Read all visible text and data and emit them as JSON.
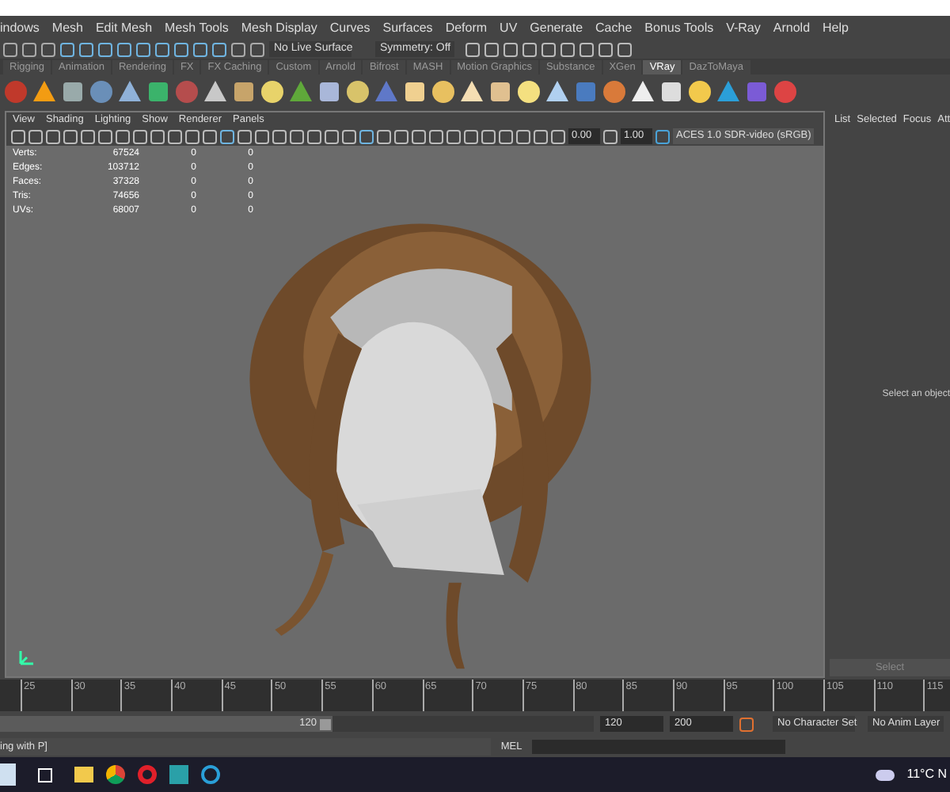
{
  "menu_bar": [
    "indows",
    "Mesh",
    "Edit Mesh",
    "Mesh Tools",
    "Mesh Display",
    "Curves",
    "Surfaces",
    "Deform",
    "UV",
    "Generate",
    "Cache",
    "Bonus Tools",
    "V-Ray",
    "Arnold",
    "Help"
  ],
  "status_line": {
    "live_surface": "No Live Surface",
    "symmetry": "Symmetry: Off"
  },
  "shelf_tabs": [
    {
      "label": "Rigging",
      "selected": false
    },
    {
      "label": "Animation",
      "selected": false
    },
    {
      "label": "Rendering",
      "selected": false
    },
    {
      "label": "FX",
      "selected": false
    },
    {
      "label": "FX Caching",
      "selected": false
    },
    {
      "label": "Custom",
      "selected": false
    },
    {
      "label": "Arnold",
      "selected": false
    },
    {
      "label": "Bifrost",
      "selected": false
    },
    {
      "label": "MASH",
      "selected": false
    },
    {
      "label": "Motion Graphics",
      "selected": false
    },
    {
      "label": "Substance",
      "selected": false
    },
    {
      "label": "XGen",
      "selected": false
    },
    {
      "label": "VRay",
      "selected": true
    },
    {
      "label": "DazToMaya",
      "selected": false
    }
  ],
  "viewport": {
    "menu": [
      "View",
      "Shading",
      "Lighting",
      "Show",
      "Renderer",
      "Panels"
    ],
    "exposure": "0.00",
    "gamma": "1.00",
    "color_space": "ACES 1.0 SDR-video (sRGB)",
    "stats": [
      [
        "Verts:",
        "67524",
        "0",
        "0"
      ],
      [
        "Edges:",
        "103712",
        "0",
        "0"
      ],
      [
        "Faces:",
        "37328",
        "0",
        "0"
      ],
      [
        "Tris:",
        "74656",
        "0",
        "0"
      ],
      [
        "UVs:",
        "68007",
        "0",
        "0"
      ]
    ]
  },
  "side_panel": {
    "tabs": [
      "List",
      "Selected",
      "Focus",
      "Att"
    ],
    "message": "Select an object",
    "button": "Select"
  },
  "timeline": {
    "ticks": [
      "25",
      "30",
      "35",
      "40",
      "45",
      "50",
      "55",
      "60",
      "65",
      "70",
      "75",
      "80",
      "85",
      "90",
      "95",
      "100",
      "105",
      "110",
      "115"
    ]
  },
  "range": {
    "level": 0.56,
    "slider_end": "120",
    "end": "120",
    "max": "200",
    "character_set": "No Character Set",
    "anim_layer": "No Anim Layer"
  },
  "command_line": {
    "output": "ing with P]",
    "language": "MEL"
  },
  "taskbar": {
    "weather": "11°C N"
  }
}
